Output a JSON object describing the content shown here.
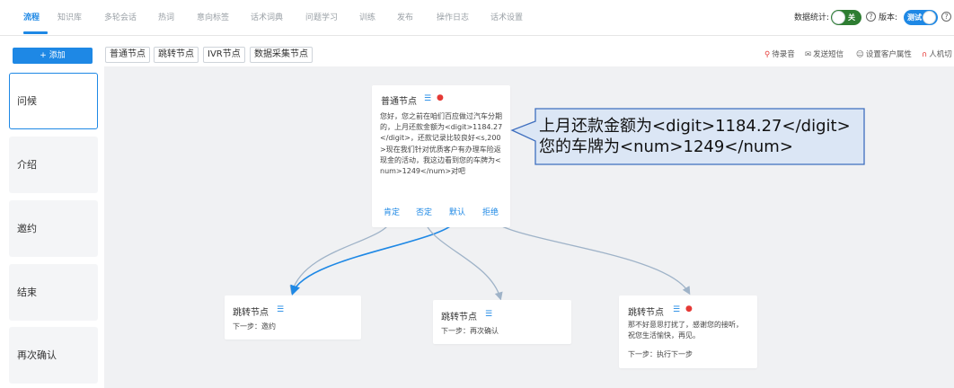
{
  "nav": {
    "tabs": [
      "流程",
      "知识库",
      "多轮会话",
      "热词",
      "意向标签",
      "话术词典",
      "问题学习",
      "训练",
      "发布",
      "操作日志",
      "话术设置"
    ],
    "stats_label": "数据统计:",
    "stats_toggle": "关",
    "version_label": "版本:",
    "version_toggle": "测试",
    "help_glyph": "?"
  },
  "toolbar": {
    "add_label": "+ 添加",
    "node_types": [
      "普通节点",
      "跳转节点",
      "IVR节点",
      "数据采集节点"
    ],
    "actions": [
      "待录音",
      "发送短信",
      "设置客户属性",
      "人机切"
    ]
  },
  "sidebar": {
    "stages": [
      "问候",
      "介绍",
      "邀约",
      "结束",
      "再次确认"
    ]
  },
  "canvas": {
    "main_node": {
      "title": "普通节点",
      "text": "您好，您之前在咱们百应做过汽车分期的，上月还款金额为<digit>1184.27</digit>，还款记录比较良好<s,200>现在我们针对优质客户有办理车险返现金的活动，我这边看到您的车牌为<num>1249</num>对吧",
      "intents": [
        "肯定",
        "否定",
        "默认",
        "拒绝"
      ]
    },
    "jump_nodes": [
      {
        "title": "跳转节点",
        "next": "下一步：邀约"
      },
      {
        "title": "跳转节点",
        "next": "下一步：再次确认"
      },
      {
        "title": "跳转节点",
        "text": "那不好意思打扰了，感谢您的接听，祝您生活愉快，再见。",
        "next": "下一步：执行下一步"
      }
    ],
    "callout": {
      "line1": "上月还款金额为<digit>1184.27</digit>",
      "line2": "您的车牌为<num>1249</num>"
    }
  },
  "colors": {
    "accent": "#1e88e5",
    "toggle_on": "#2e7d32",
    "mic": "#e53935",
    "callout_bg": "#dbe6f5",
    "callout_border": "#3f6fbf"
  }
}
